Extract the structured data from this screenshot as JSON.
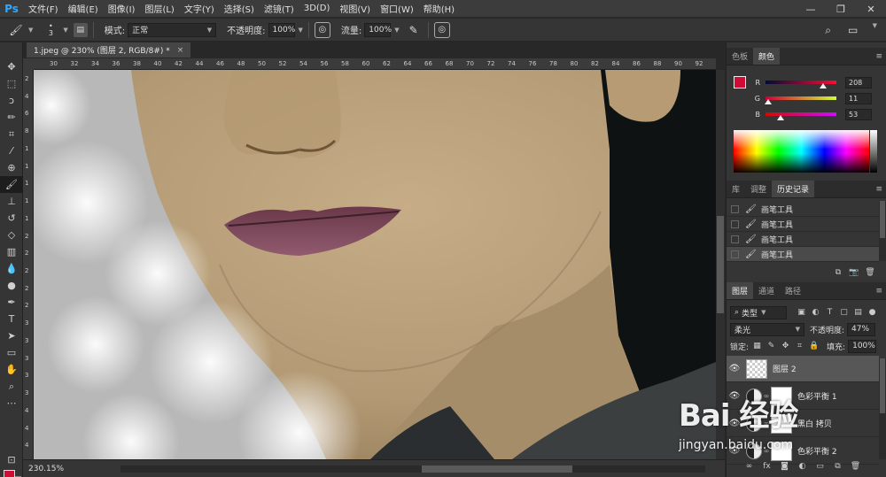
{
  "app": {
    "logo": "Ps",
    "menus": [
      "文件(F)",
      "编辑(E)",
      "图像(I)",
      "图层(L)",
      "文字(Y)",
      "选择(S)",
      "滤镜(T)",
      "3D(D)",
      "视图(V)",
      "窗口(W)",
      "帮助(H)"
    ],
    "window_controls": [
      "—",
      "❐",
      "✕"
    ]
  },
  "options": {
    "brush_size": "3",
    "mode_label": "模式:",
    "mode_value": "正常",
    "opacity_label": "不透明度:",
    "opacity_value": "100%",
    "flow_label": "流量:",
    "flow_value": "100%"
  },
  "document": {
    "tab_title": "1.jpeg @ 230% (图层 2, RGB/8#) *",
    "close": "×",
    "zoom": "230.15%"
  },
  "rulers": {
    "top": [
      "30",
      "32",
      "34",
      "36",
      "38",
      "40",
      "42",
      "44",
      "46",
      "48",
      "50",
      "52",
      "54",
      "56",
      "58",
      "60",
      "62",
      "64",
      "66",
      "68",
      "70",
      "72",
      "74",
      "76",
      "78",
      "80",
      "82",
      "84",
      "86",
      "88",
      "90",
      "92"
    ],
    "left": [
      "2",
      "4",
      "6",
      "8",
      "1",
      "1",
      "1",
      "1",
      "1",
      "2",
      "2",
      "2",
      "2",
      "2",
      "3",
      "3",
      "3",
      "3",
      "3",
      "4",
      "4",
      "4"
    ]
  },
  "color_panel": {
    "tabs": [
      "色板",
      "颜色"
    ],
    "active_tab": "颜色",
    "foreground": "#d00b35",
    "r_label": "R",
    "r_value": "208",
    "r_fraction": 0.816,
    "g_label": "G",
    "g_value": "11",
    "g_fraction": 0.043,
    "b_label": "B",
    "b_value": "53",
    "b_fraction": 0.208
  },
  "history_panel": {
    "tabs": [
      "库",
      "调整",
      "历史记录"
    ],
    "active_tab": "历史记录",
    "items": [
      "画笔工具",
      "画笔工具",
      "画笔工具",
      "画笔工具"
    ]
  },
  "layers_panel": {
    "tabs": [
      "图层",
      "通道",
      "路径"
    ],
    "active_tab": "图层",
    "filter_label": "类型",
    "blend_mode": "柔光",
    "opacity_label": "不透明度:",
    "opacity_value": "47%",
    "lock_label": "锁定:",
    "fill_label": "填充:",
    "fill_value": "100%",
    "layers": [
      {
        "name": "图层 2",
        "kind": "pixel",
        "selected": true
      },
      {
        "name": "色彩平衡 1",
        "kind": "adjustment",
        "selected": false
      },
      {
        "name": "黑白 拷贝",
        "kind": "adjustment",
        "selected": false
      },
      {
        "name": "色彩平衡 2",
        "kind": "adjustment",
        "selected": false
      }
    ]
  },
  "watermark": {
    "logo": "Bai 经验",
    "url": "jingyan.baidu.com"
  }
}
